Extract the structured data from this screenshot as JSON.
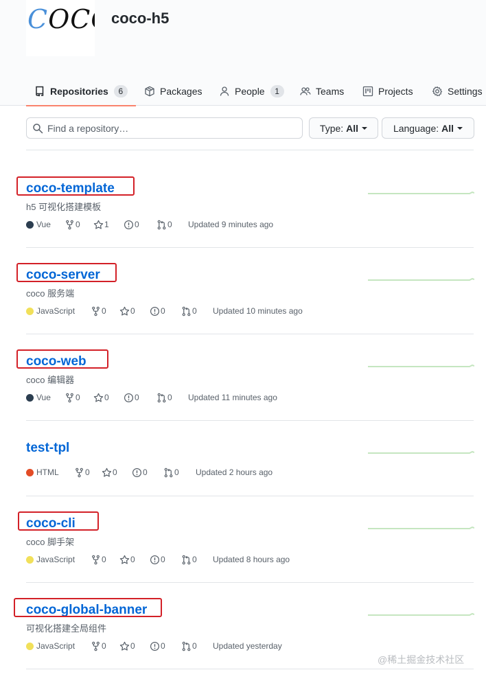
{
  "org": {
    "logo_text_first": "C",
    "logo_text_rest": "OCO",
    "name": "coco-h5"
  },
  "tabs": [
    {
      "label": "Repositories",
      "count": "6",
      "icon": "repo-icon",
      "active": true
    },
    {
      "label": "Packages",
      "icon": "package-icon"
    },
    {
      "label": "People",
      "count": "1",
      "icon": "person-icon"
    },
    {
      "label": "Teams",
      "icon": "people-icon"
    },
    {
      "label": "Projects",
      "icon": "project-icon"
    },
    {
      "label": "Settings",
      "icon": "gear-icon"
    }
  ],
  "search": {
    "placeholder": "Find a repository…",
    "value": ""
  },
  "filters": [
    {
      "label": "Type:",
      "value": "All"
    },
    {
      "label": "Language:",
      "value": "All"
    }
  ],
  "colors": {
    "link": "#0366d6",
    "tab_underline": "#f9826c",
    "highlight": "#d32027",
    "sparkline": "#c5e6c0",
    "vue": "#2c3e50",
    "javascript": "#f1e05a",
    "html": "#e34c26"
  },
  "repos": [
    {
      "name": "coco-template",
      "description": "h5 可视化搭建模板",
      "language": "Vue",
      "lang_color": "#2c3e50",
      "forks": "0",
      "stars": "1",
      "issues": "0",
      "pulls": "0",
      "updated": "Updated 9 minutes ago",
      "highlighted": true
    },
    {
      "name": "coco-server",
      "description": "coco 服务端",
      "language": "JavaScript",
      "lang_color": "#f1e05a",
      "forks": "0",
      "stars": "0",
      "issues": "0",
      "pulls": "0",
      "updated": "Updated 10 minutes ago",
      "highlighted": true
    },
    {
      "name": "coco-web",
      "description": "coco 编辑器",
      "language": "Vue",
      "lang_color": "#2c3e50",
      "forks": "0",
      "stars": "0",
      "issues": "0",
      "pulls": "0",
      "updated": "Updated 11 minutes ago",
      "highlighted": true
    },
    {
      "name": "test-tpl",
      "description": "",
      "language": "HTML",
      "lang_color": "#e34c26",
      "forks": "0",
      "stars": "0",
      "issues": "0",
      "pulls": "0",
      "updated": "Updated 2 hours ago",
      "highlighted": false
    },
    {
      "name": "coco-cli",
      "description": "coco 脚手架",
      "language": "JavaScript",
      "lang_color": "#f1e05a",
      "forks": "0",
      "stars": "0",
      "issues": "0",
      "pulls": "0",
      "updated": "Updated 8 hours ago",
      "highlighted": true
    },
    {
      "name": "coco-global-banner",
      "description": "可视化搭建全局组件",
      "language": "JavaScript",
      "lang_color": "#f1e05a",
      "forks": "0",
      "stars": "0",
      "issues": "0",
      "pulls": "0",
      "updated": "Updated yesterday",
      "highlighted": true
    }
  ],
  "watermark": "@稀土掘金技术社区"
}
